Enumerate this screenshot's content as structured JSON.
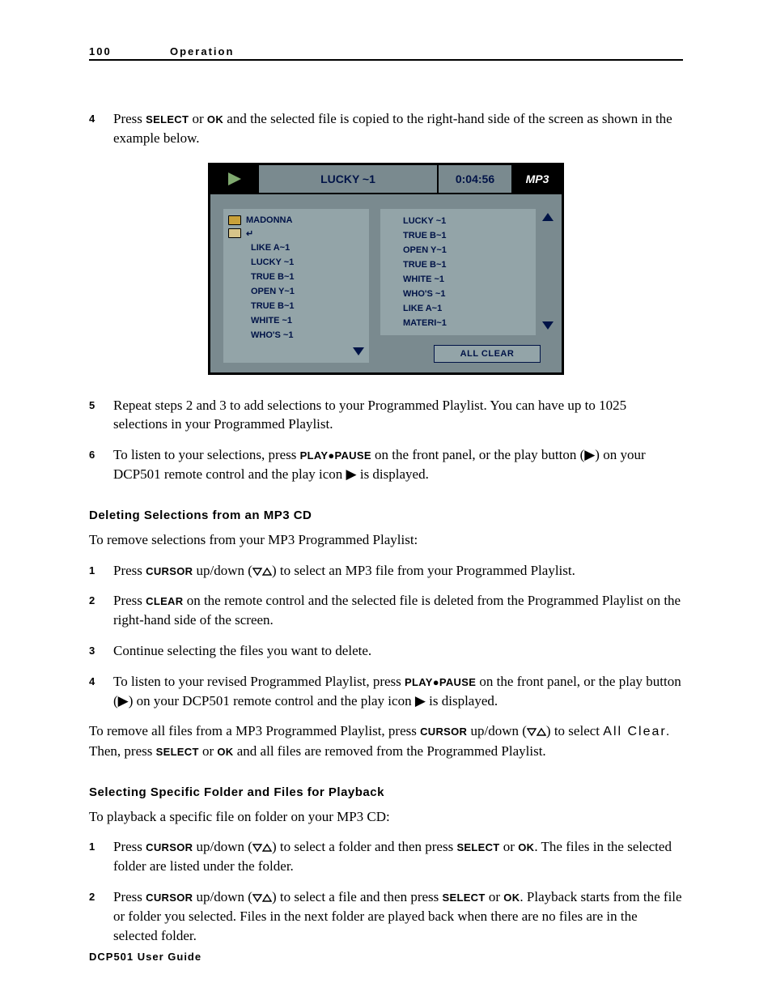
{
  "header": {
    "page_number": "100",
    "section": "Operation"
  },
  "footer": "DCP501 User Guide",
  "step4": {
    "num": "4",
    "pre": "Press ",
    "sc1": "SELECT",
    "mid1": " or ",
    "sc2": "OK",
    "post": " and the selected file is copied to the right-hand side of the screen as shown in the example below."
  },
  "ill": {
    "title": "LUCKY ~1",
    "time": "0:04:56",
    "mp3": "MP3",
    "folder": "MADONNA",
    "back": "↵",
    "left_files": [
      "LIKE A~1",
      "LUCKY ~1",
      "TRUE B~1",
      "OPEN Y~1",
      "TRUE B~1",
      "WHITE ~1",
      "WHO'S ~1"
    ],
    "right_files": [
      "LUCKY ~1",
      "TRUE B~1",
      "OPEN Y~1",
      "TRUE B~1",
      "WHITE ~1",
      "WHO'S ~1",
      "LIKE A~1",
      "MATERI~1"
    ],
    "all_clear": "ALL CLEAR"
  },
  "step5": {
    "num": "5",
    "text": "Repeat steps 2 and 3 to add selections to your Programmed Playlist. You can have up to 1025 selections in your Programmed Playlist."
  },
  "step6": {
    "num": "6",
    "pre": "To listen to your selections, press ",
    "sc": "PLAY●PAUSE",
    "mid": " on the front panel, or the play button (▶) on your DCP501 remote control and the play icon ▶ is displayed."
  },
  "del_head": "Deleting Selections from an MP3 CD",
  "del_intro": "To remove selections from your MP3 Programmed Playlist:",
  "del1": {
    "num": "1",
    "pre": "Press ",
    "sc": "CURSOR",
    "mid": " up/down (",
    "post": ") to select an MP3 file from your Programmed Playlist."
  },
  "del2": {
    "num": "2",
    "pre": "Press ",
    "sc": "CLEAR",
    "post": " on the remote control and the selected file is deleted from the Programmed Playlist on the right-hand side of the screen."
  },
  "del3": {
    "num": "3",
    "text": "Continue selecting the files you want to delete."
  },
  "del4": {
    "num": "4",
    "pre": "To listen to your revised Programmed Playlist, press ",
    "sc": "PLAY●PAUSE",
    "post": " on the front panel, or the play button (▶) on your DCP501 remote control and the play icon ▶ is displayed."
  },
  "del_end": {
    "pre": "To remove all files from a MP3 Programmed Playlist, press ",
    "sc1": "CURSOR",
    "mid1": " up/down (",
    "mid2": ") to select ",
    "allclear": "All Clear.",
    "mid3": " Then, press ",
    "sc2": "SELECT",
    "mid4": " or ",
    "sc3": "OK",
    "post": " and all files are removed from the Programmed Playlist."
  },
  "sel_head": "Selecting Specific Folder and Files for Playback",
  "sel_intro": "To playback a specific file on folder on your MP3 CD:",
  "sel1": {
    "num": "1",
    "pre": "Press ",
    "sc1": "CURSOR",
    "mid1": " up/down (",
    "mid2": ") to select a folder and then press ",
    "sc2": "SELECT",
    "mid3": " or ",
    "sc3": "OK",
    "post": ". The files in the selected folder are listed under the folder."
  },
  "sel2": {
    "num": "2",
    "pre": "Press ",
    "sc1": "CURSOR",
    "mid1": " up/down (",
    "mid2": ") to select a file and then press ",
    "sc2": "SELECT",
    "mid3": " or ",
    "sc3": "OK",
    "post": ". Playback starts from the file or folder you selected. Files in the next folder are played back when there are no files are in the selected folder."
  }
}
